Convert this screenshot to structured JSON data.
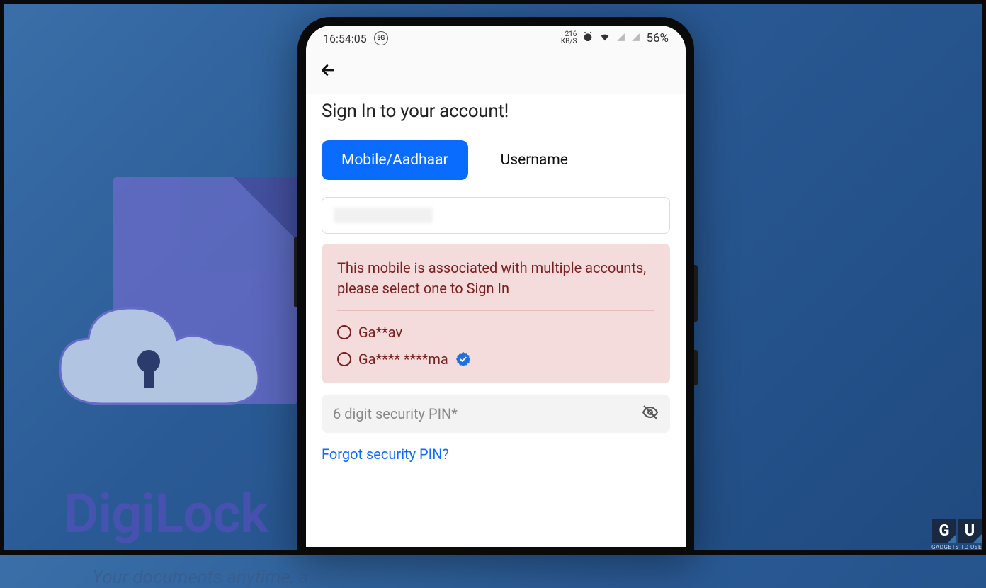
{
  "background": {
    "brand_title": "DigiLock",
    "brand_sub": "Your documents anytime, a"
  },
  "status": {
    "time": "16:54:05",
    "net_badge": "5G",
    "speed_value": "216",
    "speed_unit": "KB/S",
    "battery": "56%"
  },
  "header": {
    "back_icon": "arrow-left"
  },
  "signin": {
    "heading": "Sign In to your account!",
    "tabs": {
      "mobile": "Mobile/Aadhaar",
      "username": "Username",
      "active": "mobile"
    },
    "input_value": "",
    "alert": {
      "message": "This mobile is associated with multiple accounts, please select one to Sign In",
      "accounts": [
        {
          "label": "Ga**av",
          "verified": false
        },
        {
          "label": "Ga**** ****ma",
          "verified": true
        }
      ]
    },
    "pin_placeholder": "6 digit security PIN*",
    "forgot_label": "Forgot security PIN?"
  },
  "watermark": {
    "text": "GADGETS TO USE"
  }
}
